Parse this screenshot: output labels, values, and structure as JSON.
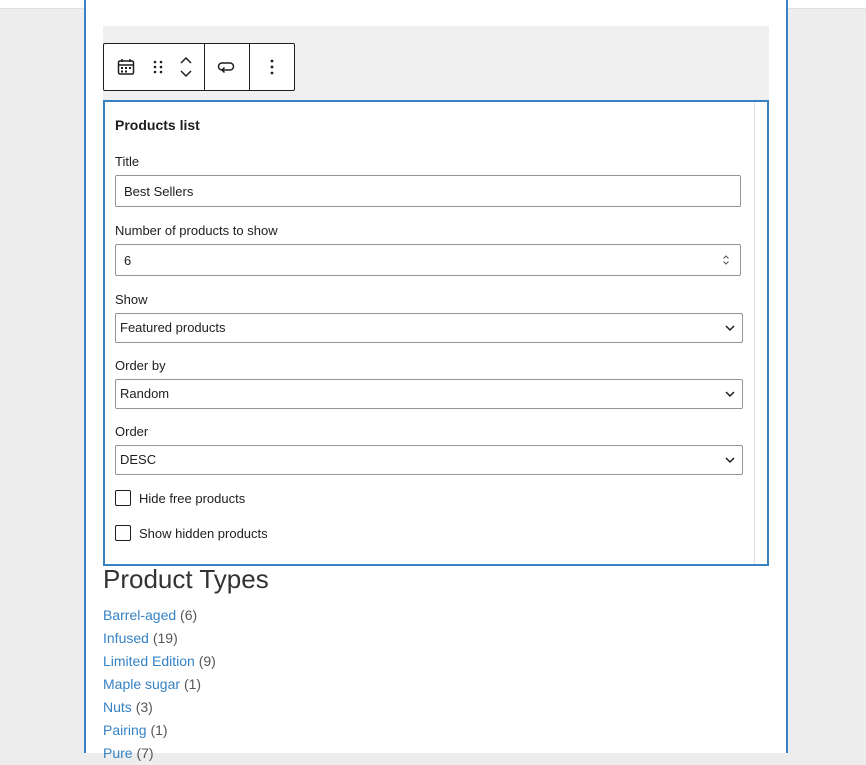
{
  "toolbar": {
    "block_icon": "calendar-icon",
    "drag_icon": "drag-handle-icon",
    "move_up_icon": "chevron-up-icon",
    "move_down_icon": "chevron-down-icon",
    "transform_icon": "loop-icon",
    "more_icon": "more-vertical-icon"
  },
  "panel": {
    "title": "Products list",
    "title_label": "Title",
    "title_value": "Best Sellers",
    "number_label": "Number of products to show",
    "number_value": "6",
    "show_label": "Show",
    "show_value": "Featured products",
    "orderby_label": "Order by",
    "orderby_value": "Random",
    "order_label": "Order",
    "order_value": "DESC",
    "hide_free_label": "Hide free products",
    "show_hidden_label": "Show hidden products"
  },
  "product_types": {
    "heading": "Product Types",
    "items": [
      {
        "name": "Barrel-aged",
        "count": "(6)"
      },
      {
        "name": "Infused",
        "count": "(19)"
      },
      {
        "name": "Limited Edition",
        "count": "(9)"
      },
      {
        "name": "Maple sugar",
        "count": "(1)"
      },
      {
        "name": "Nuts",
        "count": "(3)"
      },
      {
        "name": "Pairing",
        "count": "(1)"
      },
      {
        "name": "Pure",
        "count": "(7)"
      }
    ]
  },
  "colors": {
    "accent": "#3582c4",
    "text": "#1e1e1e"
  }
}
